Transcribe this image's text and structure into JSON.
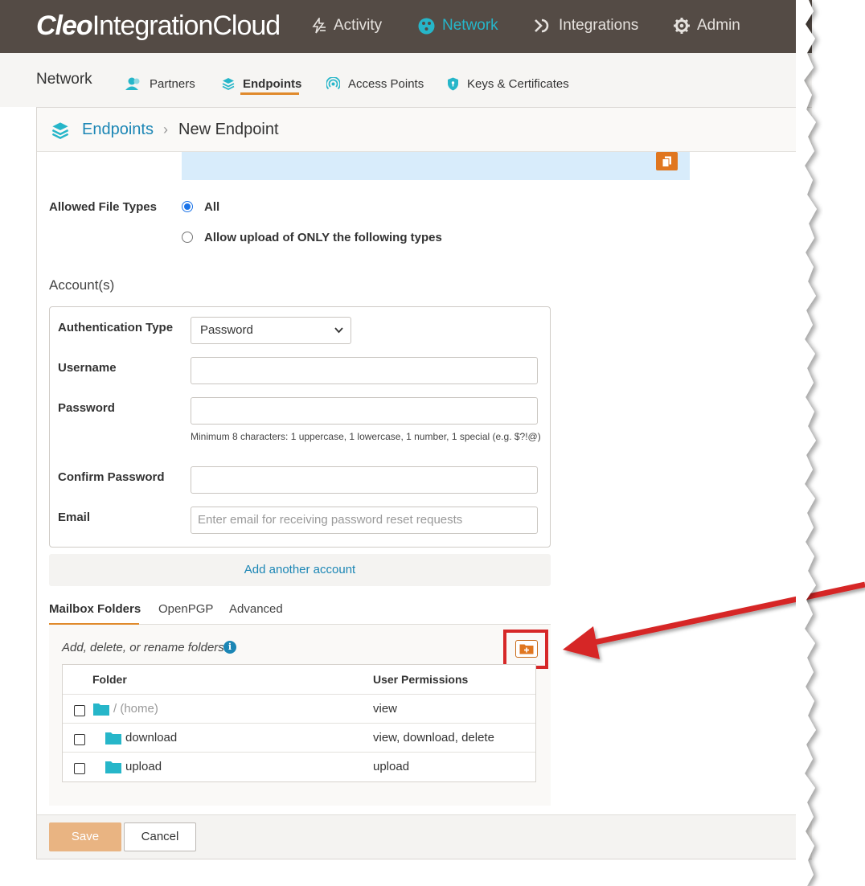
{
  "app": {
    "logo_bold": "Cleo",
    "logo_rest": "IntegrationCloud"
  },
  "topnav": {
    "items": [
      {
        "label": "Activity",
        "icon": "activity-icon"
      },
      {
        "label": "Network",
        "icon": "network-icon",
        "active": true
      },
      {
        "label": "Integrations",
        "icon": "integrations-icon"
      },
      {
        "label": "Admin",
        "icon": "gear-icon"
      }
    ]
  },
  "subnav": {
    "title": "Network",
    "items": [
      {
        "label": "Partners",
        "icon": "partners-icon"
      },
      {
        "label": "Endpoints",
        "icon": "layers-icon",
        "active": true
      },
      {
        "label": "Access Points",
        "icon": "access-point-icon"
      },
      {
        "label": "Keys & Certificates",
        "icon": "shield-icon"
      }
    ]
  },
  "breadcrumb": {
    "parent": "Endpoints",
    "separator": "›",
    "current": "New Endpoint"
  },
  "file_types": {
    "label": "Allowed File Types",
    "options": [
      {
        "label": "All",
        "selected": true
      },
      {
        "label": "Allow upload of ONLY the following types",
        "selected": false
      }
    ]
  },
  "accounts": {
    "section_title": "Account(s)",
    "auth_type_label": "Authentication Type",
    "auth_type_value": "Password",
    "username_label": "Username",
    "username_value": "",
    "password_label": "Password",
    "password_value": "",
    "password_hint": "Minimum 8 characters: 1 uppercase, 1 lowercase, 1 number, 1 special (e.g. $?!@)",
    "confirm_label": "Confirm Password",
    "confirm_value": "",
    "email_label": "Email",
    "email_placeholder": "Enter email for receiving password reset requests",
    "add_account": "Add another account"
  },
  "tabs": [
    {
      "label": "Mailbox Folders",
      "active": true
    },
    {
      "label": "OpenPGP"
    },
    {
      "label": "Advanced"
    }
  ],
  "folders": {
    "note": "Add, delete, or rename folders",
    "columns": [
      "Folder",
      "User Permissions"
    ],
    "rows": [
      {
        "name": "/ (home)",
        "permissions": "view",
        "checked": false
      },
      {
        "name": "download",
        "permissions": "view, download, delete",
        "checked": false
      },
      {
        "name": "upload",
        "permissions": "upload",
        "checked": false
      }
    ]
  },
  "footer": {
    "save": "Save",
    "cancel": "Cancel"
  },
  "colors": {
    "topbar": "#544b45",
    "accent_teal": "#26b6c9",
    "accent_orange": "#e08a2c",
    "link_blue": "#1b86b5",
    "annotation_red": "#d62828"
  }
}
